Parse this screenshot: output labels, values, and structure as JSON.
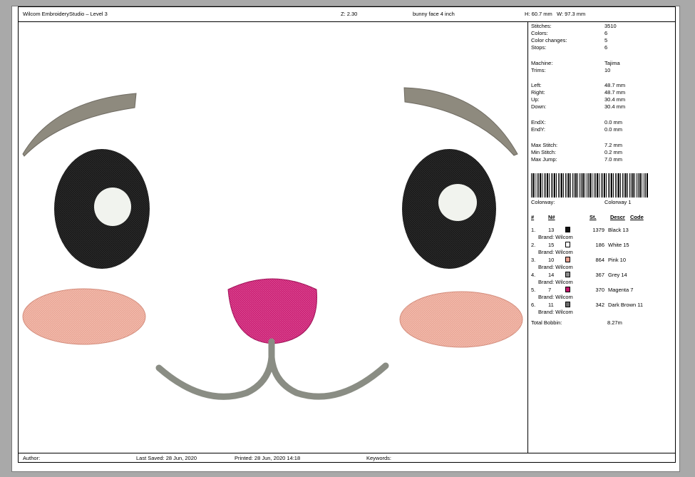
{
  "header": {
    "app_title": "Wilcom EmbroideryStudio – Level 3",
    "zoom": "Z: 2.30",
    "design_name": "bunny face 4 inch",
    "height": "H: 60.7 mm",
    "width": "W: 97.3 mm"
  },
  "stats": [
    {
      "label": "Stitches:",
      "value": "3510"
    },
    {
      "label": "Colors:",
      "value": "6"
    },
    {
      "label": "Color changes:",
      "value": "5"
    },
    {
      "label": "Stops:",
      "value": "6"
    },
    {
      "label": "Machine:",
      "value": "Tajima"
    },
    {
      "label": "Trims:",
      "value": "10"
    },
    {
      "label": "Left:",
      "value": "48.7 mm"
    },
    {
      "label": "Right:",
      "value": "48.7 mm"
    },
    {
      "label": "Up:",
      "value": "30.4 mm"
    },
    {
      "label": "Down:",
      "value": "30.4 mm"
    },
    {
      "label": "EndX:",
      "value": "0.0 mm"
    },
    {
      "label": "EndY:",
      "value": "0.0 mm"
    },
    {
      "label": "Max Stitch:",
      "value": "7.2 mm"
    },
    {
      "label": "Min Stitch:",
      "value": "0.2 mm"
    },
    {
      "label": "Max Jump:",
      "value": "7.0 mm"
    }
  ],
  "colorway": {
    "label": "Colorway:",
    "value": "Colorway 1"
  },
  "color_table": {
    "headers": {
      "index": "#",
      "number": "N#",
      "stitches": "St.",
      "descr": "Descr",
      "code": "Code"
    },
    "rows": [
      {
        "index": "1.",
        "number": "13",
        "color": "#111111",
        "stitches": "1379",
        "descr": "Black 13",
        "brand": "Brand: Wilcom"
      },
      {
        "index": "2.",
        "number": "15",
        "color": "#ffffff",
        "stitches": "186",
        "descr": "White 15",
        "brand": "Brand: Wilcom"
      },
      {
        "index": "3.",
        "number": "10",
        "color": "#e8a090",
        "stitches": "864",
        "descr": "Pink 10",
        "brand": "Brand: Wilcom"
      },
      {
        "index": "4.",
        "number": "14",
        "color": "#8c8c8c",
        "stitches": "367",
        "descr": "Grey 14",
        "brand": "Brand: Wilcom"
      },
      {
        "index": "5.",
        "number": "7",
        "color": "#c2186b",
        "stitches": "370",
        "descr": "Magenta 7",
        "brand": "Brand: Wilcom"
      },
      {
        "index": "6.",
        "number": "11",
        "color": "#6b6b6b",
        "stitches": "342",
        "descr": "Dark Brown 11",
        "brand": "Brand: Wilcom"
      }
    ],
    "total_label": "Total Bobbin:",
    "total_value": "8.27m"
  },
  "footer": {
    "author": "Author:",
    "last_saved": "Last Saved: 28 Jun, 2020",
    "printed": "Printed: 28 Jun, 2020 14:18",
    "keywords": "Keywords:"
  }
}
